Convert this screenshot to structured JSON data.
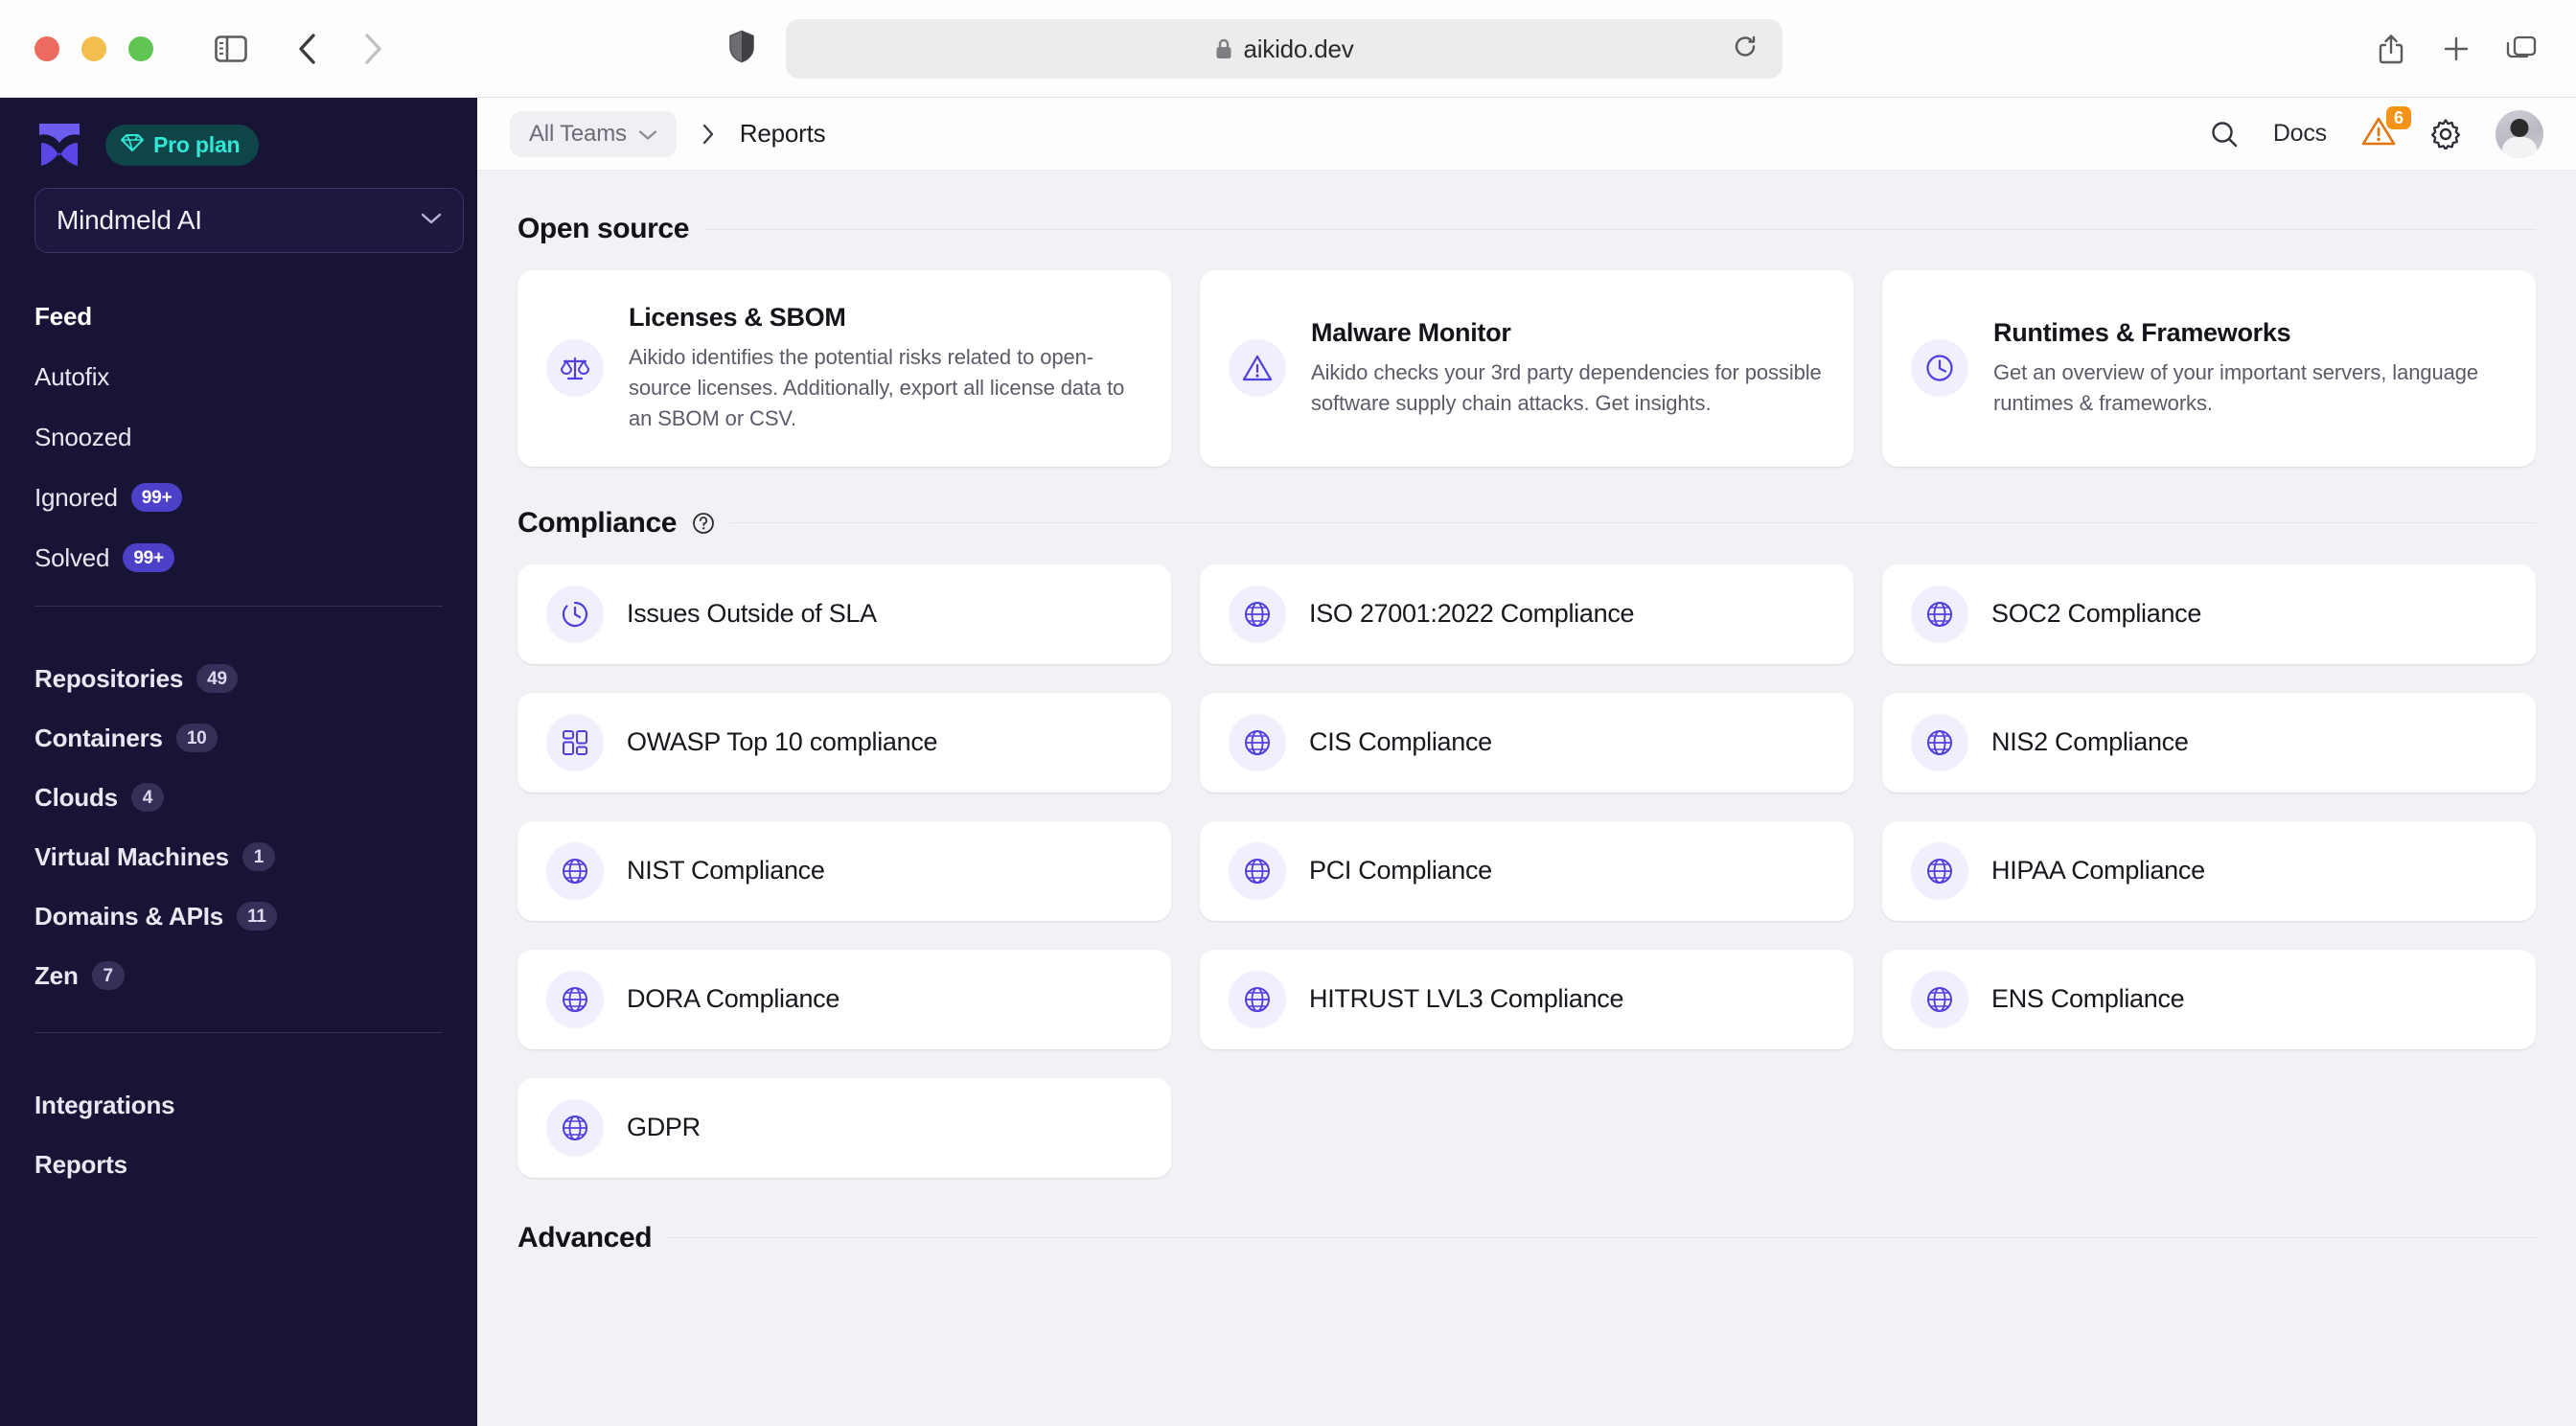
{
  "browser": {
    "url": "aikido.dev",
    "icons": {
      "sidebar_toggle": "sidebar-toggle-icon",
      "back": "back-arrow-icon",
      "forward": "forward-arrow-icon",
      "shield": "shield-icon",
      "lock": "lock-icon",
      "reload": "reload-icon",
      "share": "share-icon",
      "new_tab": "plus-icon",
      "tab_overview": "tab-overview-icon"
    }
  },
  "sidebar": {
    "plan_badge": "Pro plan",
    "org_name": "Mindmeld AI",
    "primary": [
      {
        "label": "Feed",
        "badge": null,
        "active": true
      },
      {
        "label": "Autofix",
        "badge": null,
        "active": false
      },
      {
        "label": "Snoozed",
        "badge": null,
        "active": false
      },
      {
        "label": "Ignored",
        "badge": "99+",
        "active": false
      },
      {
        "label": "Solved",
        "badge": "99+",
        "active": false
      }
    ],
    "assets": [
      {
        "label": "Repositories",
        "badge": "49"
      },
      {
        "label": "Containers",
        "badge": "10"
      },
      {
        "label": "Clouds",
        "badge": "4"
      },
      {
        "label": "Virtual Machines",
        "badge": "1"
      },
      {
        "label": "Domains & APIs",
        "badge": "11"
      },
      {
        "label": "Zen",
        "badge": "7"
      }
    ],
    "bottom": [
      {
        "label": "Integrations"
      },
      {
        "label": "Reports"
      }
    ]
  },
  "topbar": {
    "team_selector": "All Teams",
    "breadcrumb_current": "Reports",
    "docs_label": "Docs",
    "alert_count": "6"
  },
  "sections": [
    {
      "title": "Open source",
      "has_help": false,
      "cards": [
        {
          "title": "Licenses & SBOM",
          "desc": "Aikido identifies the potential risks related to open-source licenses. Additionally, export all license data to an SBOM or CSV.",
          "icon": "scale-icon"
        },
        {
          "title": "Malware Monitor",
          "desc": "Aikido checks your 3rd party dependencies for possible software supply chain attacks. Get insights.",
          "icon": "warning-triangle-icon"
        },
        {
          "title": "Runtimes & Frameworks",
          "desc": "Get an overview of your important servers, language runtimes & frameworks.",
          "icon": "clock-icon"
        }
      ]
    }
  ],
  "compliance": {
    "title": "Compliance",
    "has_help": true,
    "items": [
      {
        "title": "Issues Outside of SLA",
        "icon": "timer-icon"
      },
      {
        "title": "ISO 27001:2022 Compliance",
        "icon": "globe-icon"
      },
      {
        "title": "SOC2 Compliance",
        "icon": "globe-icon"
      },
      {
        "title": "OWASP Top 10 compliance",
        "icon": "grid-dashboard-icon"
      },
      {
        "title": "CIS Compliance",
        "icon": "globe-icon"
      },
      {
        "title": "NIS2 Compliance",
        "icon": "globe-icon"
      },
      {
        "title": "NIST Compliance",
        "icon": "globe-icon"
      },
      {
        "title": "PCI Compliance",
        "icon": "globe-icon"
      },
      {
        "title": "HIPAA Compliance",
        "icon": "globe-icon"
      },
      {
        "title": "DORA Compliance",
        "icon": "globe-icon"
      },
      {
        "title": "HITRUST LVL3 Compliance",
        "icon": "globe-icon"
      },
      {
        "title": "ENS Compliance",
        "icon": "globe-icon"
      },
      {
        "title": "GDPR",
        "icon": "globe-icon"
      }
    ]
  },
  "advanced": {
    "title": "Advanced"
  },
  "colors": {
    "sidebar_bg": "#181436",
    "accent_purple": "#4f3fe0",
    "plan_teal": "#2fe8d5",
    "alert_orange": "#f59315",
    "canvas": "#f2f2f6"
  }
}
